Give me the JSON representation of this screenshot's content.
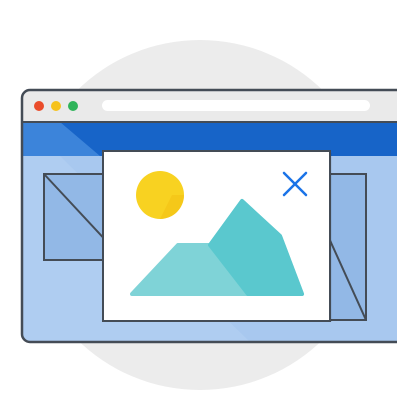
{
  "illustration": {
    "colors": {
      "backdrop_circle": "#ececec",
      "window_outline": "#444c56",
      "titlebar": "#eaeaea",
      "address_bar": "#ffffff",
      "dot_red": "#ea4c2a",
      "dot_yellow": "#f6c21c",
      "dot_green": "#2fb45a",
      "header_band": "#1764c8",
      "header_shine": "#4a8fe0",
      "page_body": "#a8c8ef",
      "wireframe_fill": "#92b8e6",
      "modal_bg": "#ffffff",
      "sun": "#f8d221",
      "mountain_back": "#5ac8ce",
      "mountain_front": "#7fd3d7",
      "close_x": "#1a73e8"
    },
    "icons": [
      "browser-window",
      "image-placeholder-icon",
      "sun-icon",
      "mountain-icon",
      "close-icon"
    ]
  }
}
